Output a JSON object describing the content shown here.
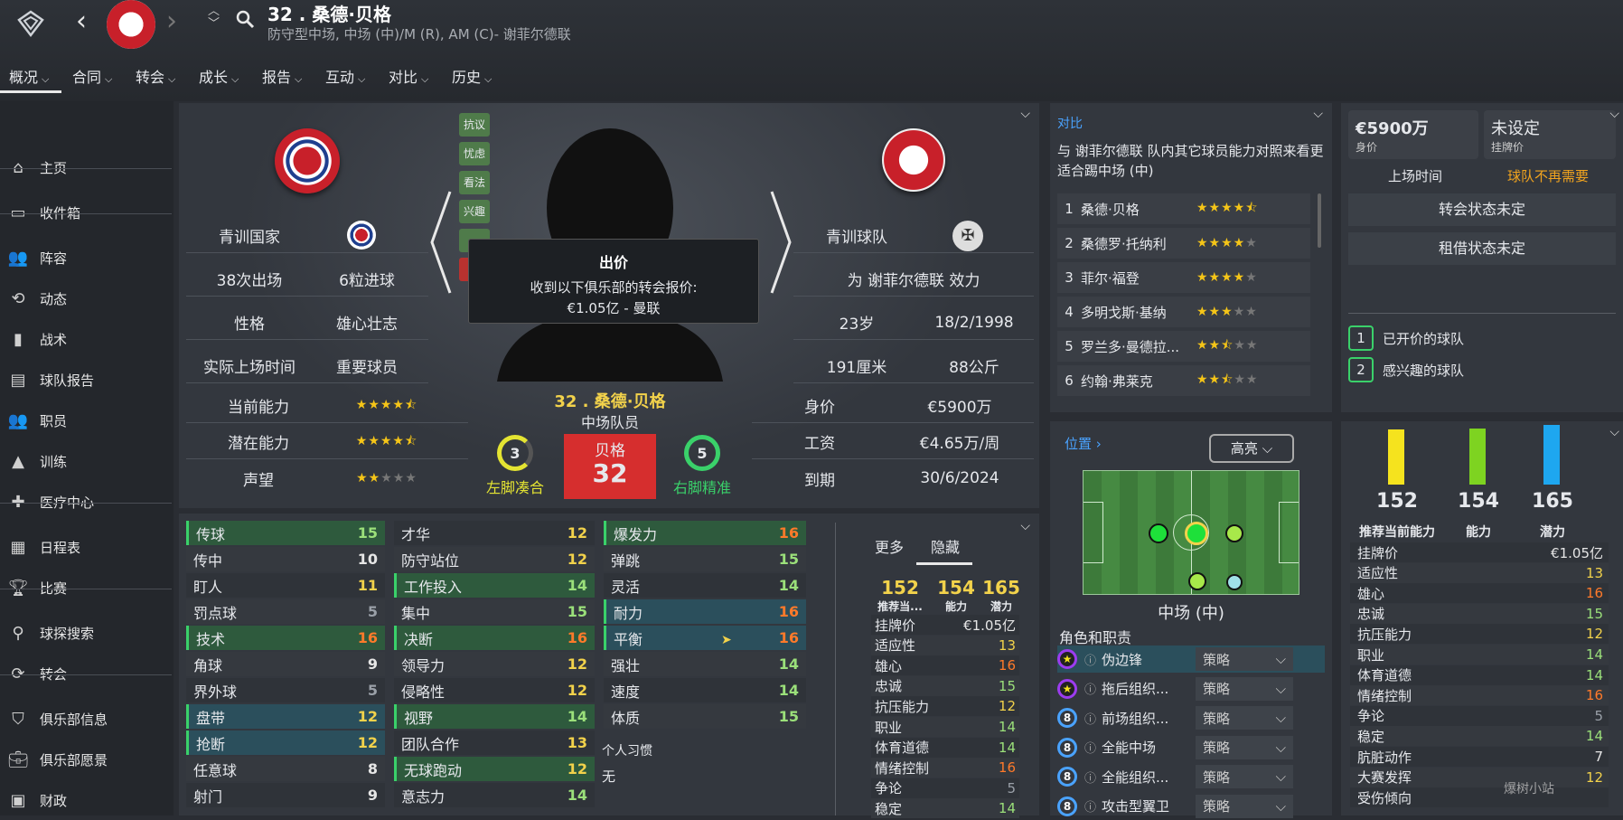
{
  "header": {
    "title": "32 . 桑德·贝格",
    "subtitle": "防守型中场, 中场 (中)/M (R), AM (C)- 谢菲尔德联"
  },
  "topnav": [
    {
      "label": "概况"
    },
    {
      "label": "合同"
    },
    {
      "label": "转会"
    },
    {
      "label": "成长"
    },
    {
      "label": "报告"
    },
    {
      "label": "互动"
    },
    {
      "label": "对比"
    },
    {
      "label": "历史"
    }
  ],
  "sidebar": {
    "items": [
      {
        "label": "主页",
        "icon": "home-icon"
      },
      {
        "label": "收件箱",
        "icon": "inbox-icon"
      },
      {
        "label": "阵容",
        "icon": "squad-icon"
      },
      {
        "label": "动态",
        "icon": "dynamics-icon"
      },
      {
        "label": "战术",
        "icon": "tactics-icon"
      },
      {
        "label": "球队报告",
        "icon": "report-icon"
      },
      {
        "label": "职员",
        "icon": "staff-icon"
      },
      {
        "label": "训练",
        "icon": "training-icon"
      },
      {
        "label": "医疗中心",
        "icon": "medical-icon"
      },
      {
        "label": "日程表",
        "icon": "calendar-icon"
      },
      {
        "label": "比赛",
        "icon": "trophy-icon"
      },
      {
        "label": "球探搜索",
        "icon": "search-icon"
      },
      {
        "label": "转会",
        "icon": "transfer-icon"
      },
      {
        "label": "俱乐部信息",
        "icon": "shield-icon"
      },
      {
        "label": "俱乐部愿景",
        "icon": "briefcase-icon"
      },
      {
        "label": "财政",
        "icon": "money-icon"
      }
    ]
  },
  "profile": {
    "nation_label": "青训国家",
    "apps": "38次出场",
    "goals": "6粒进球",
    "personality_label": "性格",
    "personality": "雄心壮志",
    "playtime_label": "实际上场时间",
    "playtime": "重要球员",
    "ca_label": "当前能力",
    "pa_label": "潜在能力",
    "rep_label": "声望",
    "club_label": "青训球队",
    "plays_for": "为 谢菲尔德联 效力",
    "age": "23岁",
    "dob": "18/2/1998",
    "height": "191厘米",
    "weight": "88公斤",
    "value_label": "身价",
    "value": "€5900万",
    "wage_label": "工资",
    "wage": "€4.65万/周",
    "expiry_label": "到期",
    "expiry": "30/6/2024",
    "name": "32 . 桑德·贝格",
    "role": "中场队员",
    "shirt_name": "贝格",
    "shirt_number": "32",
    "left_foot": "3",
    "left_foot_label": "左脚凑合",
    "right_foot": "5",
    "right_foot_label": "右脚精准",
    "side_tags": [
      "抗议",
      "忧虑",
      "看法",
      "兴趣"
    ],
    "ca_stars": 4.5,
    "pa_stars": 4.5,
    "rep_stars": 2,
    "popup": {
      "title": "出价",
      "line1": "收到以下俱乐部的转会报价:",
      "line2": "€1.05亿 - 曼联"
    }
  },
  "compare": {
    "title": "对比",
    "desc": "与 谢菲尔德联 队内其它球员能力对照来看更适合踢中场 (中)",
    "players": [
      {
        "rank": "1",
        "name": "桑德·贝格",
        "stars": 4.5
      },
      {
        "rank": "2",
        "name": "桑德罗·托纳利",
        "stars": 4
      },
      {
        "rank": "3",
        "name": "菲尔·福登",
        "stars": 4
      },
      {
        "rank": "4",
        "name": "多明戈斯·基纳",
        "stars": 3
      },
      {
        "rank": "5",
        "name": "罗兰多·曼德拉...",
        "stars": 2.5
      },
      {
        "rank": "6",
        "name": "约翰·弗莱克",
        "stars": 2.5
      }
    ]
  },
  "transfer": {
    "value": "€5900万",
    "value_label": "身价",
    "asking": "未设定",
    "asking_label": "挂牌价",
    "time_label": "上场时间",
    "status": "球队不再需要",
    "btn1": "转会状态未定",
    "btn2": "租借状态未定",
    "clubs": [
      {
        "n": "1",
        "label": "已开价的球队"
      },
      {
        "n": "2",
        "label": "感兴趣的球队"
      }
    ]
  },
  "attributes": {
    "col1": [
      {
        "n": "传球",
        "v": "15",
        "c": "g",
        "h": "hl-g"
      },
      {
        "n": "传中",
        "v": "10",
        "c": "w",
        "h": ""
      },
      {
        "n": "盯人",
        "v": "11",
        "c": "y",
        "h": ""
      },
      {
        "n": "罚点球",
        "v": "5",
        "c": "gr",
        "h": ""
      },
      {
        "n": "技术",
        "v": "16",
        "c": "o",
        "h": "hl-g"
      },
      {
        "n": "角球",
        "v": "9",
        "c": "w",
        "h": ""
      },
      {
        "n": "界外球",
        "v": "5",
        "c": "gr",
        "h": ""
      },
      {
        "n": "盘带",
        "v": "12",
        "c": "y",
        "h": "hl-t"
      },
      {
        "n": "抢断",
        "v": "12",
        "c": "y",
        "h": "hl-t"
      },
      {
        "n": "任意球",
        "v": "8",
        "c": "w",
        "h": ""
      },
      {
        "n": "射门",
        "v": "9",
        "c": "w",
        "h": ""
      }
    ],
    "col2": [
      {
        "n": "才华",
        "v": "12",
        "c": "y",
        "h": ""
      },
      {
        "n": "防守站位",
        "v": "12",
        "c": "y",
        "h": ""
      },
      {
        "n": "工作投入",
        "v": "14",
        "c": "g",
        "h": "hl-g"
      },
      {
        "n": "集中",
        "v": "15",
        "c": "g",
        "h": ""
      },
      {
        "n": "决断",
        "v": "16",
        "c": "o",
        "h": "hl-g"
      },
      {
        "n": "领导力",
        "v": "12",
        "c": "y",
        "h": ""
      },
      {
        "n": "侵略性",
        "v": "12",
        "c": "y",
        "h": ""
      },
      {
        "n": "视野",
        "v": "14",
        "c": "g",
        "h": "hl-g"
      },
      {
        "n": "团队合作",
        "v": "13",
        "c": "y",
        "h": ""
      },
      {
        "n": "无球跑动",
        "v": "12",
        "c": "y",
        "h": "hl-g"
      },
      {
        "n": "意志力",
        "v": "14",
        "c": "g",
        "h": ""
      }
    ],
    "col3": [
      {
        "n": "爆发力",
        "v": "16",
        "c": "o",
        "h": "hl-g"
      },
      {
        "n": "弹跳",
        "v": "15",
        "c": "g",
        "h": ""
      },
      {
        "n": "灵活",
        "v": "14",
        "c": "g",
        "h": ""
      },
      {
        "n": "耐力",
        "v": "16",
        "c": "o",
        "h": "hl-t"
      },
      {
        "n": "平衡",
        "v": "16",
        "c": "o",
        "h": "hl-t"
      },
      {
        "n": "强壮",
        "v": "14",
        "c": "g",
        "h": ""
      },
      {
        "n": "速度",
        "v": "14",
        "c": "g",
        "h": ""
      },
      {
        "n": "体质",
        "v": "15",
        "c": "g",
        "h": ""
      }
    ],
    "habits_label": "个人习惯",
    "habits": "无"
  },
  "summary": {
    "tab_more": "更多",
    "tab_hidden": "隐藏",
    "rec": "152",
    "rec_label": "推荐当...",
    "ca": "154",
    "ca_label": "能力",
    "pa": "165",
    "pa_label": "潜力",
    "stats": [
      {
        "n": "挂牌价",
        "v": "€1.05亿",
        "c": "w"
      },
      {
        "n": "适应性",
        "v": "13",
        "c": "y"
      },
      {
        "n": "雄心",
        "v": "16",
        "c": "o"
      },
      {
        "n": "忠诚",
        "v": "15",
        "c": "g"
      },
      {
        "n": "抗压能力",
        "v": "12",
        "c": "y"
      },
      {
        "n": "职业",
        "v": "14",
        "c": "g"
      },
      {
        "n": "体育道德",
        "v": "14",
        "c": "g"
      },
      {
        "n": "情绪控制",
        "v": "16",
        "c": "o"
      },
      {
        "n": "争论",
        "v": "5",
        "c": "gr"
      },
      {
        "n": "稳定",
        "v": "14",
        "c": "g"
      }
    ]
  },
  "position": {
    "title": "位置",
    "highlight": "高亮",
    "pos_label": "中场 (中)",
    "roles_label": "角色和职责",
    "roles": [
      {
        "badge": "star",
        "name": "伪边锋",
        "duty": "策略"
      },
      {
        "badge": "star",
        "name": "拖后组织...",
        "duty": "策略"
      },
      {
        "badge": "8",
        "name": "前场组织...",
        "duty": "策略"
      },
      {
        "badge": "8",
        "name": "全能中场",
        "duty": "策略"
      },
      {
        "badge": "8",
        "name": "全能组织...",
        "duty": "策略"
      },
      {
        "badge": "8",
        "name": "攻击型翼卫",
        "duty": "策略"
      }
    ]
  },
  "right_stats": {
    "rec": "152",
    "rec_label": "推荐当前能力",
    "ca": "154",
    "ca_label": "能力",
    "pa": "165",
    "pa_label": "潜力",
    "stats": [
      {
        "n": "挂牌价",
        "v": "€1.05亿",
        "c": "w"
      },
      {
        "n": "适应性",
        "v": "13",
        "c": "y"
      },
      {
        "n": "雄心",
        "v": "16",
        "c": "o"
      },
      {
        "n": "忠诚",
        "v": "15",
        "c": "g"
      },
      {
        "n": "抗压能力",
        "v": "12",
        "c": "y"
      },
      {
        "n": "职业",
        "v": "14",
        "c": "g"
      },
      {
        "n": "体育道德",
        "v": "14",
        "c": "g"
      },
      {
        "n": "情绪控制",
        "v": "16",
        "c": "o"
      },
      {
        "n": "争论",
        "v": "5",
        "c": "gr"
      },
      {
        "n": "稳定",
        "v": "14",
        "c": "g"
      },
      {
        "n": "肮脏动作",
        "v": "7",
        "c": "w"
      },
      {
        "n": "大赛发挥",
        "v": "12",
        "c": "y"
      },
      {
        "n": "受伤倾向",
        "v": "",
        "c": "w"
      }
    ]
  },
  "colors": {
    "green": "#9be07a",
    "yellow": "#f2d24b",
    "orange": "#ff7a2a",
    "accent": "#4aa3ff"
  },
  "watermark": "爆树小站"
}
